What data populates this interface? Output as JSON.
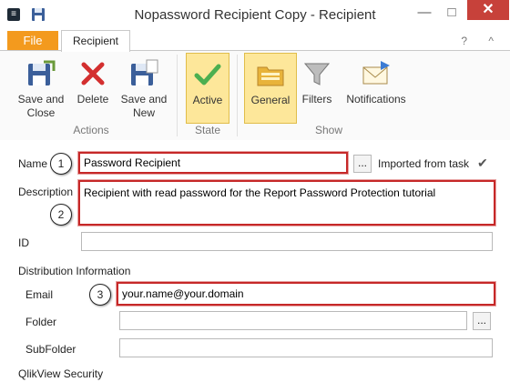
{
  "window": {
    "title": "Nopassword Recipient Copy - Recipient",
    "app_icon_glyph": "≡",
    "minimize_glyph": "—",
    "maximize_glyph": "□",
    "close_glyph": "✕"
  },
  "tabs": {
    "file_label": "File",
    "recipient_label": "Recipient",
    "help_glyph": "? ^"
  },
  "ribbon": {
    "actions": {
      "save_close_line1": "Save and",
      "save_close_line2": "Close",
      "delete_label": "Delete",
      "save_new_line1": "Save and",
      "save_new_line2": "New",
      "group_label": "Actions"
    },
    "state": {
      "active_label": "Active",
      "group_label": "State"
    },
    "show": {
      "general_label": "General",
      "filters_label": "Filters",
      "notifications_label": "Notifications",
      "group_label": "Show"
    }
  },
  "form": {
    "name_label": "Name",
    "name_value": "Password Recipient",
    "name_browse": "...",
    "imported_label": "Imported from task",
    "imported_check": "✔",
    "description_label": "Description",
    "description_value": "Recipient with read password for the Report Password Protection tutorial",
    "id_label": "ID",
    "id_value": "",
    "distribution_header": "Distribution Information",
    "email_label": "Email",
    "email_value": "your.name@your.domain",
    "folder_label": "Folder",
    "folder_value": "",
    "folder_browse": "...",
    "subfolder_label": "SubFolder",
    "subfolder_value": "",
    "security_header": "QlikView Security"
  },
  "callouts": [
    "1",
    "2",
    "3"
  ],
  "colors": {
    "file_tab": "#f39a1e",
    "active_highlight": "#fde79a",
    "callout_border": "#c62828",
    "close_button": "#c7413a"
  }
}
